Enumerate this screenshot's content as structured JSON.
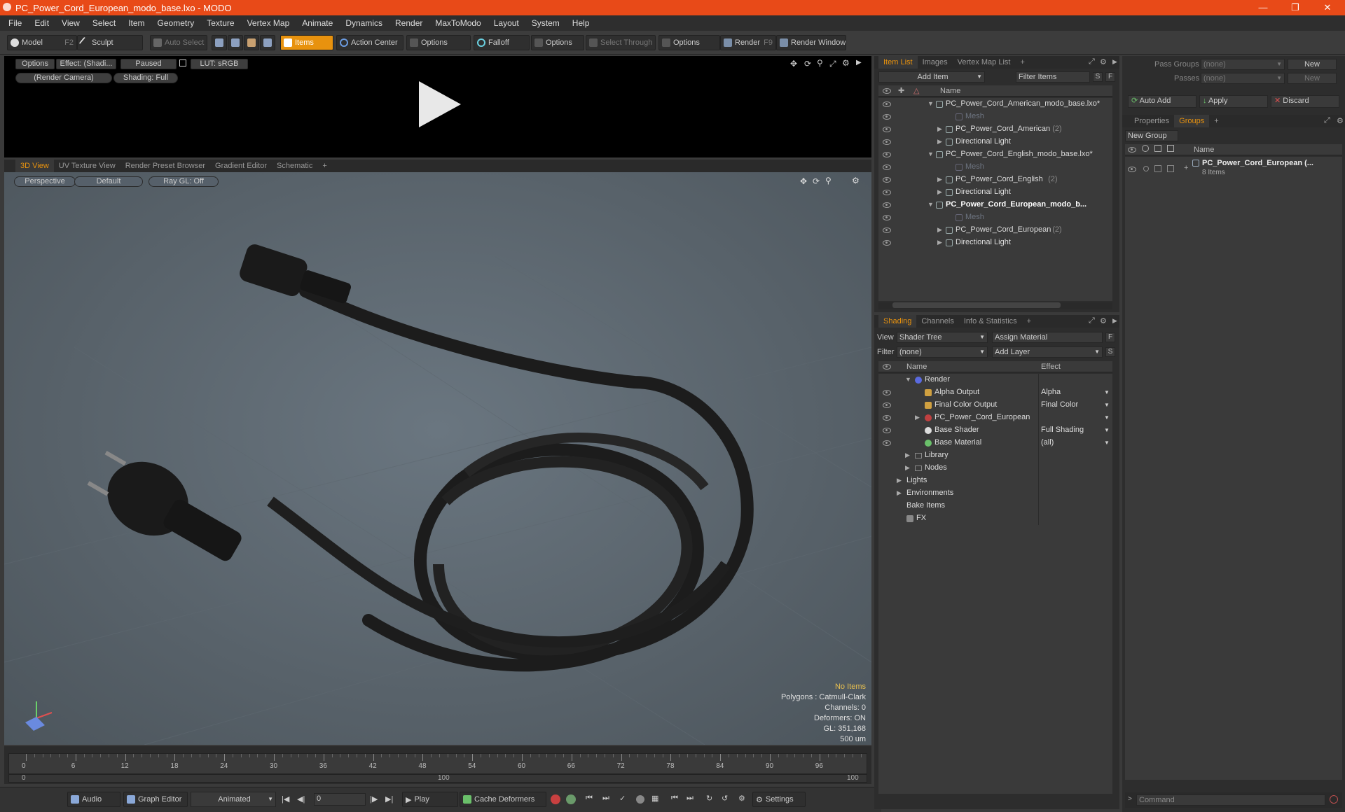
{
  "window": {
    "title": "PC_Power_Cord_European_modo_base.lxo - MODO"
  },
  "menu": [
    "File",
    "Edit",
    "View",
    "Select",
    "Item",
    "Geometry",
    "Texture",
    "Vertex Map",
    "Animate",
    "Dynamics",
    "Render",
    "MaxToModo",
    "Layout",
    "System",
    "Help"
  ],
  "toolbar": {
    "model": "Model",
    "model_key": "F2",
    "sculpt": "Sculpt",
    "auto_select": "Auto Select",
    "items": "Items",
    "action_center": "Action Center",
    "options1": "Options",
    "falloff": "Falloff",
    "options2": "Options",
    "select_through": "Select Through",
    "options3": "Options",
    "render": "Render",
    "render_key": "F9",
    "render_window": "Render Window"
  },
  "preview": {
    "options": "Options",
    "effect": "Effect: (Shadi...",
    "paused": "Paused",
    "lut": "LUT: sRGB",
    "camera": "(Render Camera)",
    "shading": "Shading: Full"
  },
  "viewport": {
    "tabs": [
      "3D View",
      "UV Texture View",
      "Render Preset Browser",
      "Gradient Editor",
      "Schematic"
    ],
    "perspective": "Perspective",
    "default": "Default",
    "raygl": "Ray GL: Off"
  },
  "status": {
    "no_items": "No Items",
    "polygons": "Polygons : Catmull-Clark",
    "channels": "Channels: 0",
    "deformers": "Deformers: ON",
    "gl": "GL: 351,168",
    "scale": "500 um"
  },
  "timeline": {
    "ticks": [
      "0",
      "6",
      "12",
      "18",
      "24",
      "30",
      "36",
      "42",
      "48",
      "54",
      "60",
      "66",
      "72",
      "78",
      "84",
      "90",
      "96"
    ],
    "range_start": "0",
    "range_mid": "100",
    "range_end": "100"
  },
  "bottom": {
    "audio": "Audio",
    "graph_editor": "Graph Editor",
    "animated": "Animated",
    "frame": "0",
    "play": "Play",
    "cache": "Cache Deformers",
    "settings": "Settings"
  },
  "itemlist": {
    "tabs": [
      "Item List",
      "Images",
      "Vertex Map List"
    ],
    "add_item": "Add Item",
    "filter_items": "Filter Items",
    "s": "S",
    "f": "F",
    "col_name": "Name",
    "rows": [
      {
        "label": "PC_Power_Cord_American_modo_base.lxo*",
        "lvl": 0,
        "bold": false,
        "dim": false,
        "count": ""
      },
      {
        "label": "Mesh",
        "lvl": 2,
        "bold": false,
        "dim": true,
        "count": ""
      },
      {
        "label": "PC_Power_Cord_American",
        "lvl": 1,
        "bold": false,
        "dim": false,
        "count": "(2)"
      },
      {
        "label": "Directional Light",
        "lvl": 1,
        "bold": false,
        "dim": false,
        "count": ""
      },
      {
        "label": "PC_Power_Cord_English_modo_base.lxo*",
        "lvl": 0,
        "bold": false,
        "dim": false,
        "count": ""
      },
      {
        "label": "Mesh",
        "lvl": 2,
        "bold": false,
        "dim": true,
        "count": ""
      },
      {
        "label": "PC_Power_Cord_English",
        "lvl": 1,
        "bold": false,
        "dim": false,
        "count": "(2)"
      },
      {
        "label": "Directional Light",
        "lvl": 1,
        "bold": false,
        "dim": false,
        "count": ""
      },
      {
        "label": "PC_Power_Cord_European_modo_b...",
        "lvl": 0,
        "bold": true,
        "dim": false,
        "count": ""
      },
      {
        "label": "Mesh",
        "lvl": 2,
        "bold": false,
        "dim": true,
        "count": ""
      },
      {
        "label": "PC_Power_Cord_European",
        "lvl": 1,
        "bold": false,
        "dim": false,
        "count": "(2)"
      },
      {
        "label": "Directional Light",
        "lvl": 1,
        "bold": false,
        "dim": false,
        "count": ""
      }
    ]
  },
  "shading": {
    "tabs": [
      "Shading",
      "Channels",
      "Info & Statistics"
    ],
    "view_label": "View",
    "view": "Shader Tree",
    "assign": "Assign Material",
    "filter_label": "Filter",
    "filter": "(none)",
    "add_layer": "Add Layer",
    "col_name": "Name",
    "col_effect": "Effect",
    "rows": [
      {
        "label": "Render",
        "effect": "",
        "x": 52
      },
      {
        "label": "Alpha Output",
        "effect": "Alpha",
        "x": 66
      },
      {
        "label": "Final Color Output",
        "effect": "Final Color",
        "x": 66
      },
      {
        "label": "PC_Power_Cord_European",
        "effect": "",
        "x": 66
      },
      {
        "label": "Base Shader",
        "effect": "Full Shading",
        "x": 66
      },
      {
        "label": "Base Material",
        "effect": "(all)",
        "x": 66
      },
      {
        "label": "Library",
        "effect": "",
        "x": 52
      },
      {
        "label": "Nodes",
        "effect": "",
        "x": 52
      },
      {
        "label": "Lights",
        "effect": "",
        "x": 40
      },
      {
        "label": "Environments",
        "effect": "",
        "x": 40
      },
      {
        "label": "Bake Items",
        "effect": "",
        "x": 40
      },
      {
        "label": "FX",
        "effect": "",
        "x": 40
      }
    ]
  },
  "right": {
    "pass_groups": "Pass Groups",
    "passes": "Passes",
    "none1": "(none)",
    "none2": "(none)",
    "new1": "New",
    "new2": "New",
    "auto_add": "Auto Add",
    "apply": "Apply",
    "discard": "Discard",
    "tabs": [
      "Properties",
      "Groups"
    ],
    "new_group": "New Group",
    "col_name": "Name",
    "group_name": "PC_Power_Cord_European (...",
    "group_sub": "8 Items",
    "command": "Command"
  }
}
